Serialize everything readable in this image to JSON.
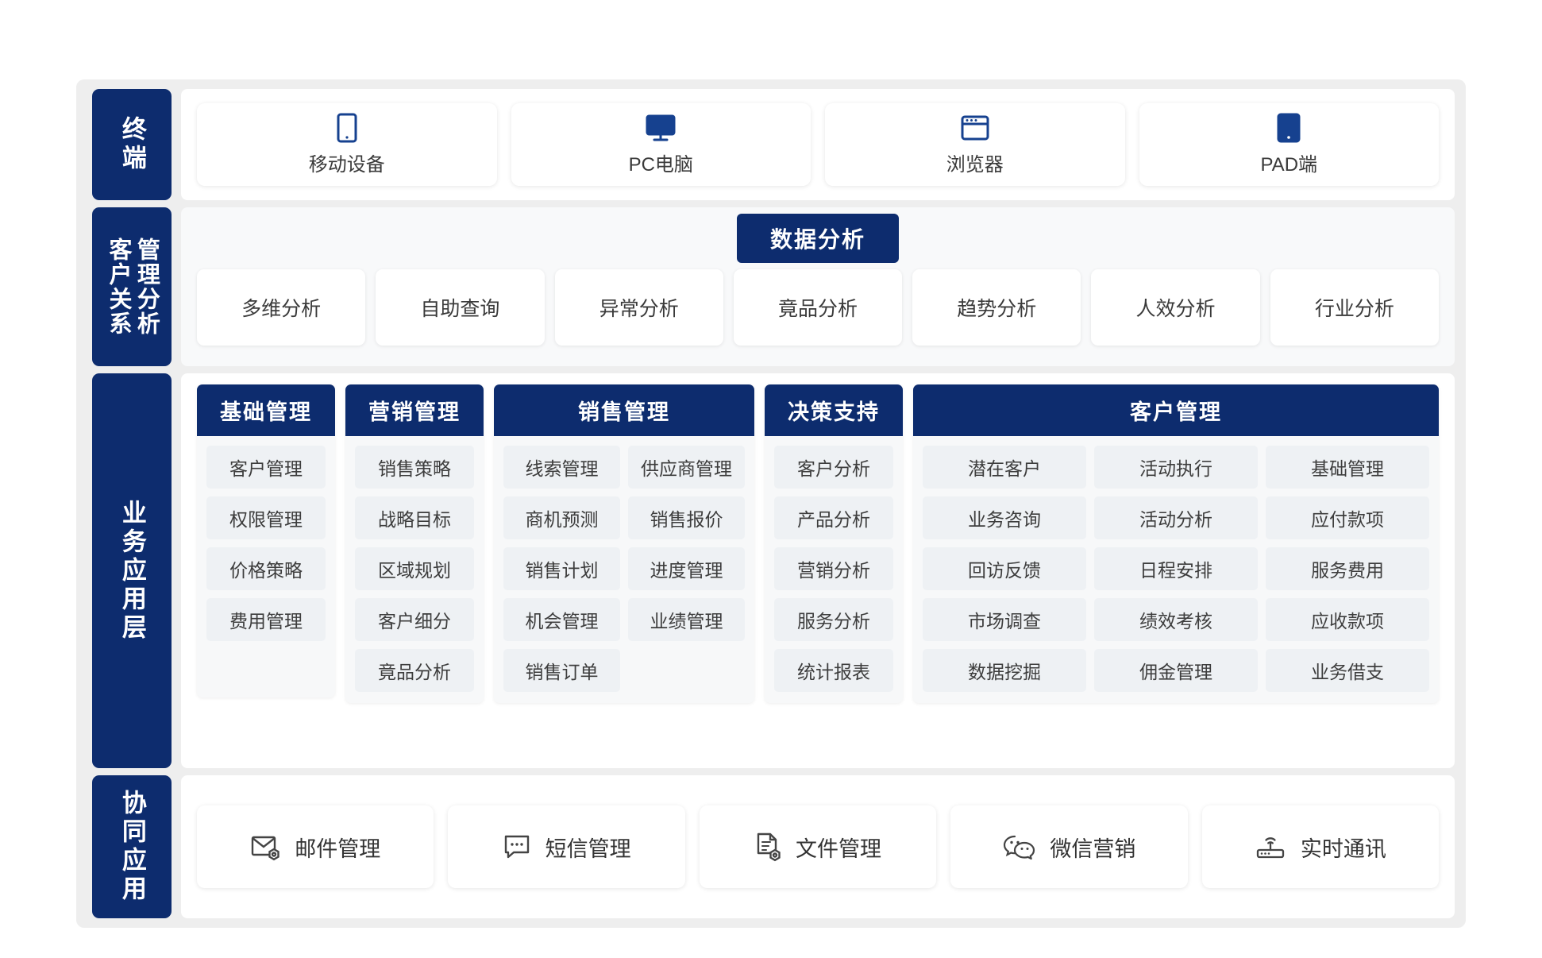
{
  "sidebar": {
    "terminal": "终端",
    "crm_left": "客户关系",
    "crm_right": "管理分析",
    "business": "业务应用层",
    "collab": "协同应用"
  },
  "terminal": {
    "items": [
      {
        "label": "移动设备",
        "icon": "mobile-icon"
      },
      {
        "label": "PC电脑",
        "icon": "monitor-icon"
      },
      {
        "label": "浏览器",
        "icon": "browser-icon"
      },
      {
        "label": "PAD端",
        "icon": "tablet-icon"
      }
    ]
  },
  "analysis": {
    "title": "数据分析",
    "items": [
      "多维分析",
      "自助查询",
      "异常分析",
      "竟品分析",
      "趋势分析",
      "人效分析",
      "行业分析"
    ]
  },
  "business": {
    "groups": [
      {
        "title": "基础管理",
        "columns": [
          [
            "客户管理",
            "权限管理",
            "价格策略",
            "费用管理"
          ]
        ]
      },
      {
        "title": "营销管理",
        "columns": [
          [
            "销售策略",
            "战略目标",
            "区域规划",
            "客户细分",
            "竟品分析"
          ]
        ]
      },
      {
        "title": "销售管理",
        "columns": [
          [
            "线索管理",
            "商机预测",
            "销售计划",
            "机会管理",
            "销售订单"
          ],
          [
            "供应商管理",
            "销售报价",
            "进度管理",
            "业绩管理"
          ]
        ]
      },
      {
        "title": "决策支持",
        "columns": [
          [
            "客户分析",
            "产品分析",
            "营销分析",
            "服务分析",
            "统计报表"
          ]
        ]
      },
      {
        "title": "客户管理",
        "columns": [
          [
            "潜在客户",
            "业务咨询",
            "回访反馈",
            "市场调查",
            "数据挖掘"
          ],
          [
            "活动执行",
            "活动分析",
            "日程安排",
            "绩效考核",
            "佣金管理"
          ],
          [
            "基础管理",
            "应付款项",
            "服务费用",
            "应收款项",
            "业务借支"
          ]
        ]
      }
    ]
  },
  "collab": {
    "items": [
      {
        "label": "邮件管理",
        "icon": "mail-settings-icon"
      },
      {
        "label": "短信管理",
        "icon": "message-bubble-icon"
      },
      {
        "label": "文件管理",
        "icon": "document-settings-icon"
      },
      {
        "label": "微信营销",
        "icon": "wechat-icon"
      },
      {
        "label": "实时通讯",
        "icon": "router-wifi-icon"
      }
    ]
  },
  "colors": {
    "brand_navy": "#0d2c6e",
    "icon_blue": "#16418f",
    "frame_grey": "#eeeeee",
    "chip_grey": "#eef1f4"
  }
}
